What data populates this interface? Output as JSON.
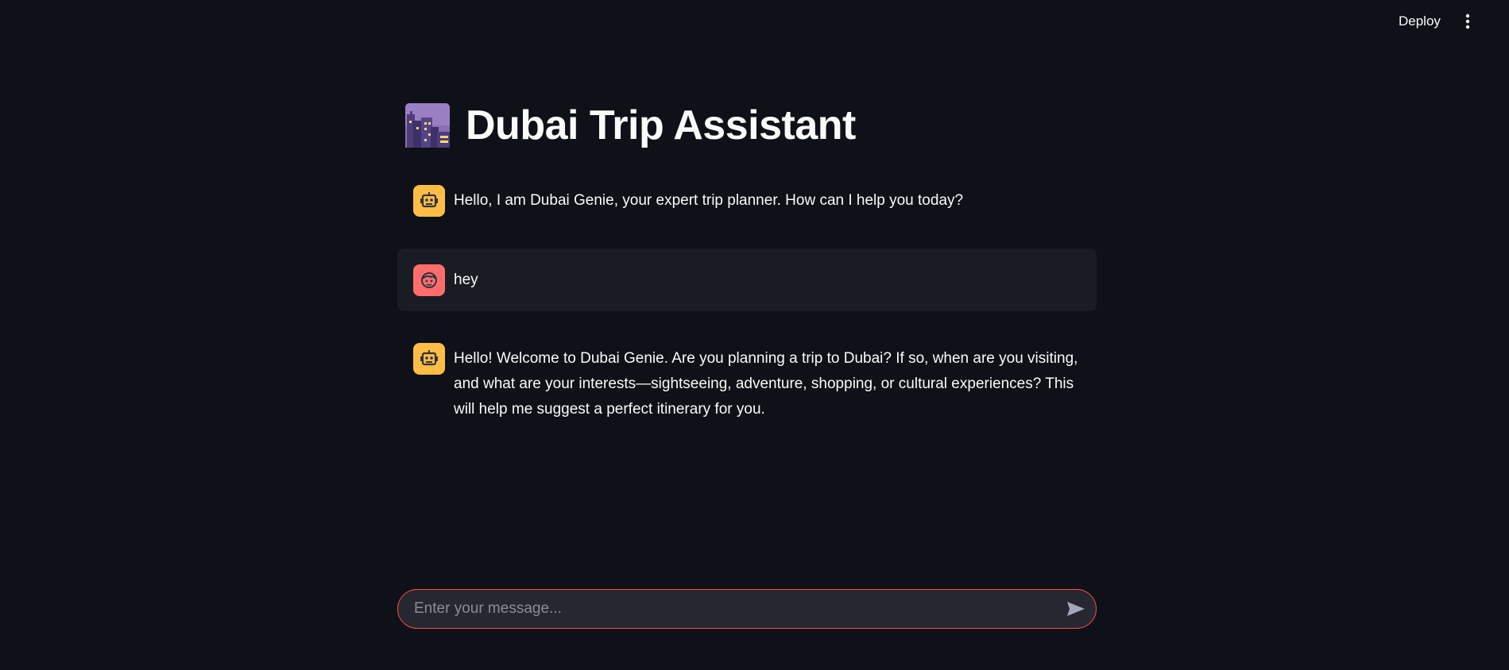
{
  "header": {
    "deploy_label": "Deploy",
    "menu_icon": "vertical-ellipsis-icon"
  },
  "page": {
    "title": "Dubai Trip Assistant",
    "title_icon": "night-cityscape-icon"
  },
  "messages": [
    {
      "role": "assistant",
      "avatar_icon": "robot-icon",
      "text": "Hello, I am Dubai Genie, your expert trip planner. How can I help you today?"
    },
    {
      "role": "user",
      "avatar_icon": "user-face-icon",
      "text": "hey"
    },
    {
      "role": "assistant",
      "avatar_icon": "robot-icon",
      "text": "Hello! Welcome to Dubai Genie. Are you planning a trip to Dubai? If so, when are you visiting, and what are your interests—sightseeing, adventure, shopping, or cultural experiences? This will help me suggest a perfect itinerary for you."
    }
  ],
  "chat_input": {
    "placeholder": "Enter your message...",
    "value": "",
    "send_icon": "send-icon"
  },
  "colors": {
    "background": "#0e1117",
    "text": "#fafafa",
    "assistant_avatar": "#ffbd45",
    "user_avatar": "#ff6c6c",
    "user_message_bg": "#1a1c24",
    "input_bg": "#262730",
    "input_border_focus": "#ff4b4b"
  }
}
